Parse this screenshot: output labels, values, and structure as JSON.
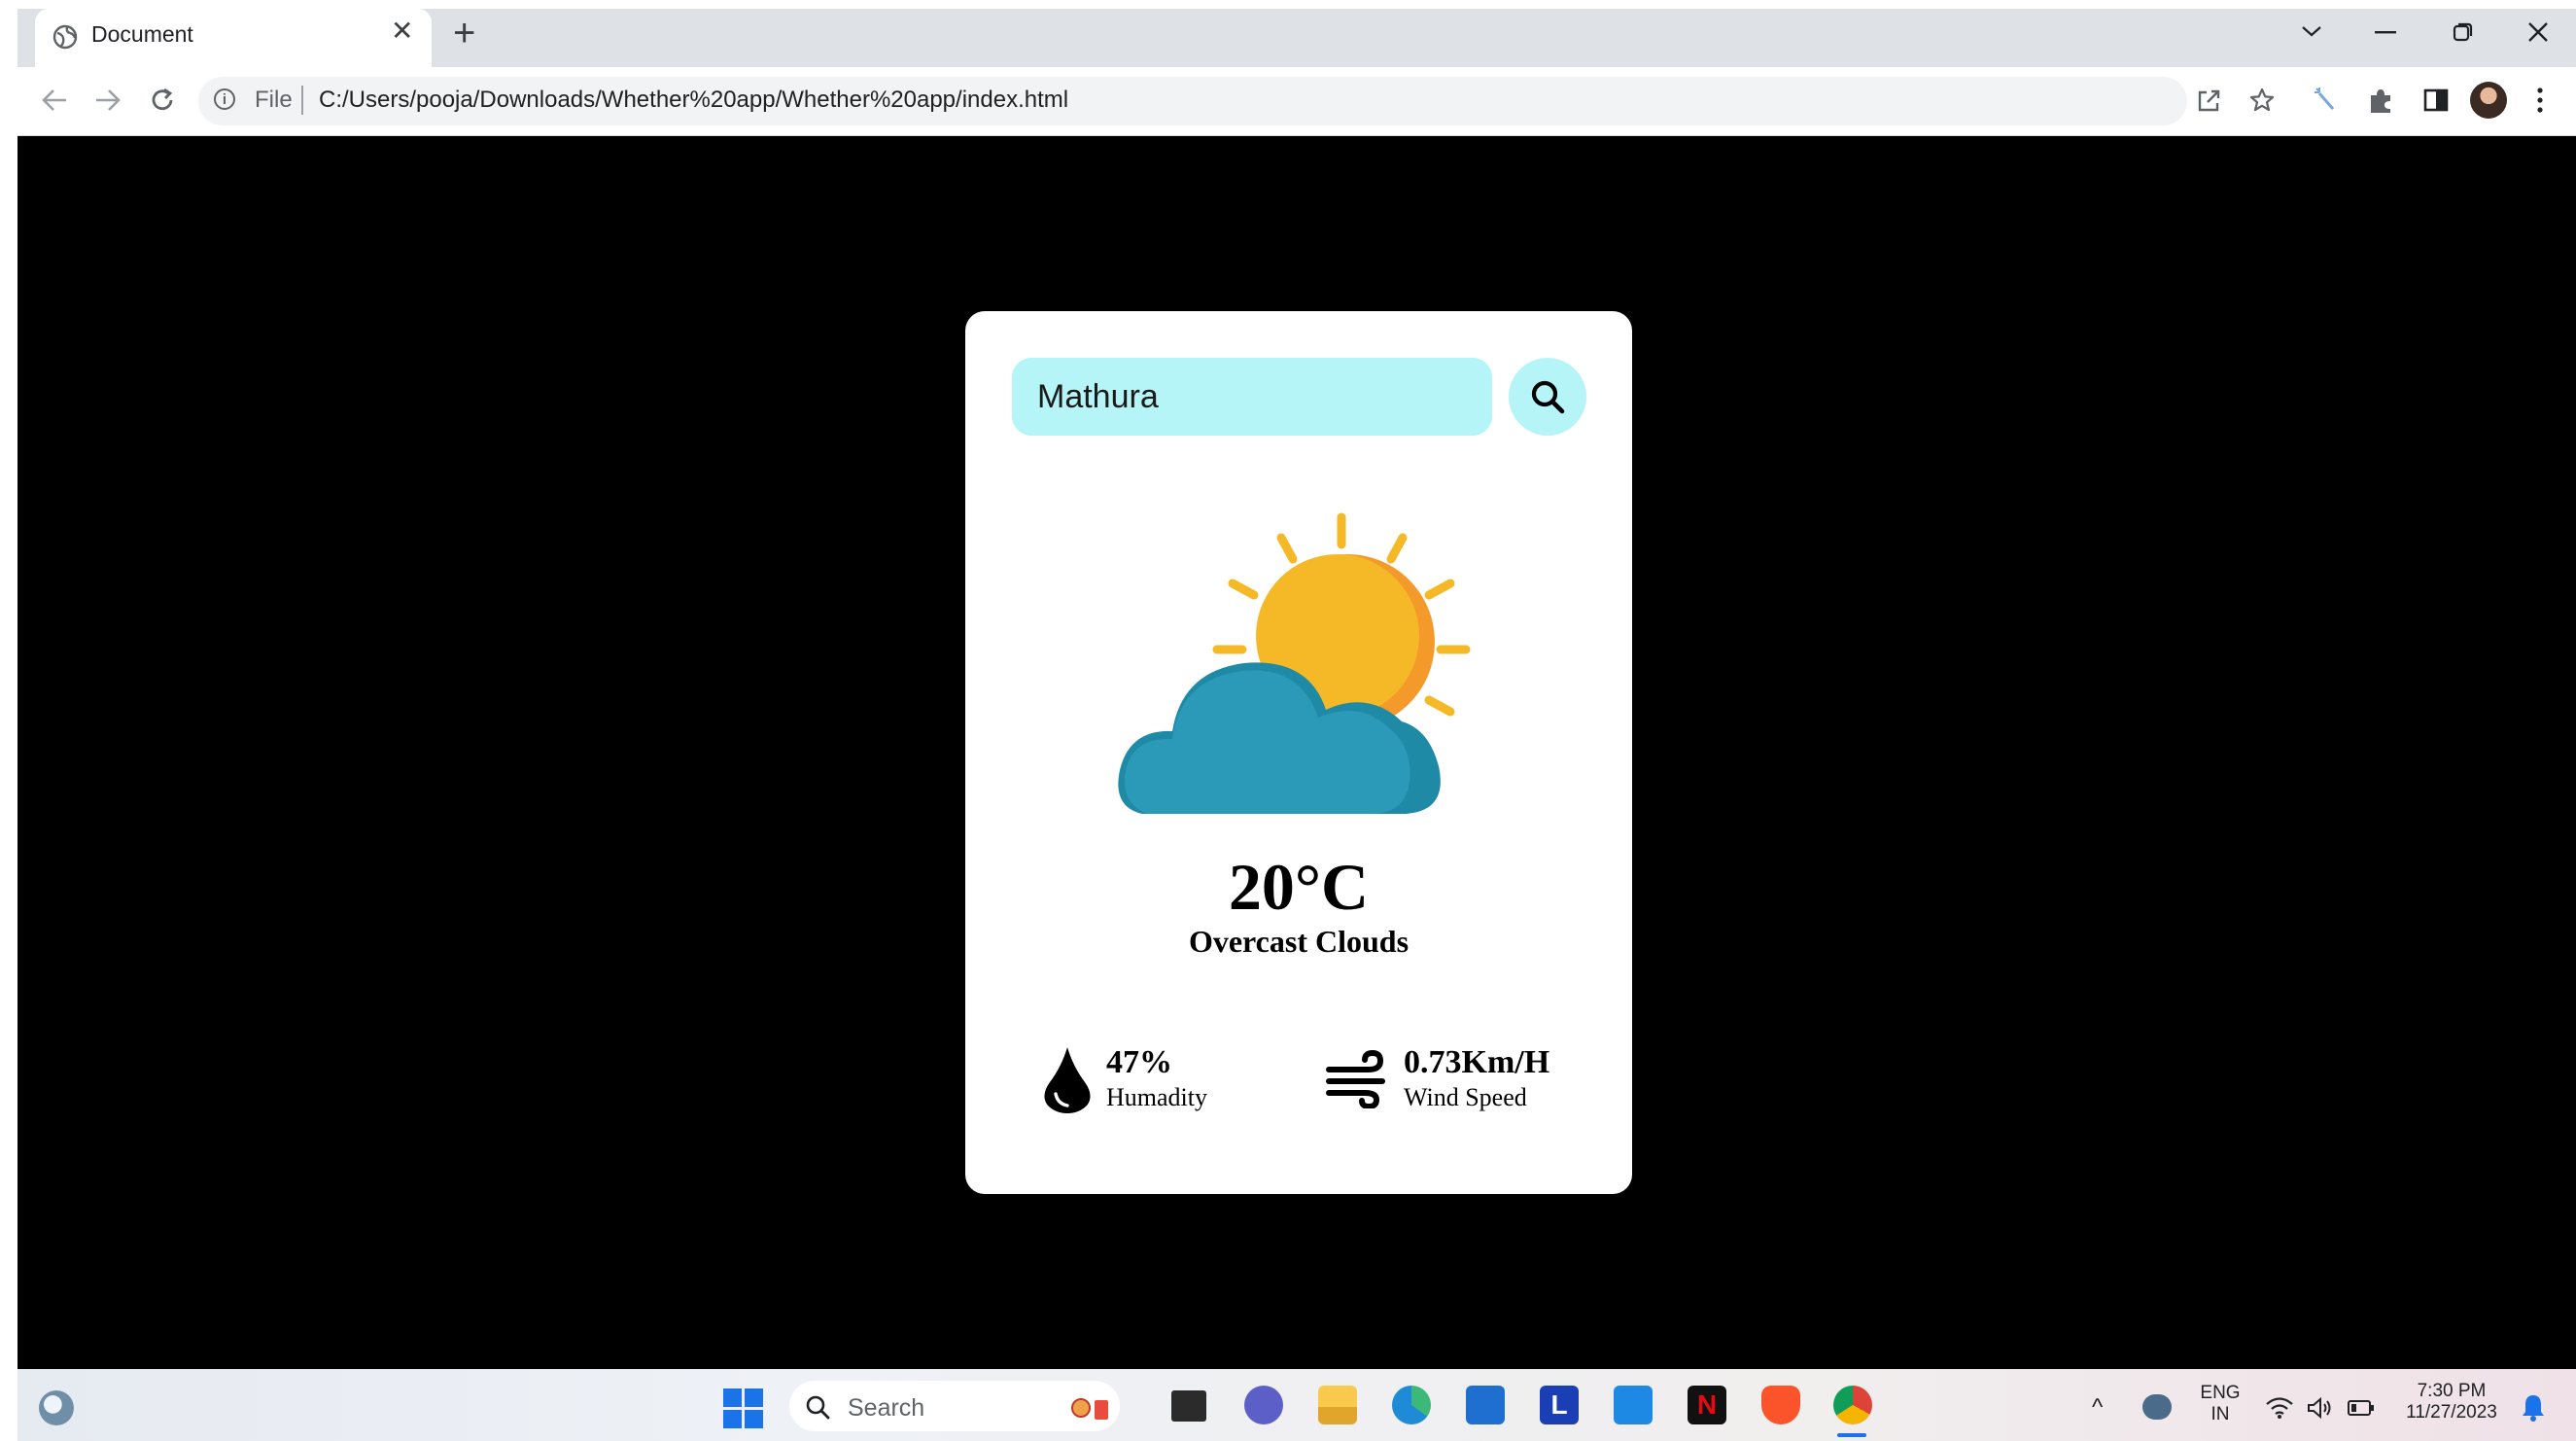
{
  "browser": {
    "tab_title": "Document",
    "tab_close": "✕",
    "new_tab": "+",
    "file_label": "File",
    "url": "C:/Users/pooja/Downloads/Whether%20app/Whether%20app/index.html",
    "info_glyph": "i"
  },
  "weather": {
    "city_value": "Mathura",
    "temperature": "20°C",
    "condition": "Overcast Clouds",
    "humidity_value": "47%",
    "humidity_label": "Humadity",
    "wind_value": "0.73Km/H",
    "wind_label": "Wind Speed",
    "icon": "sun-behind-cloud-icon"
  },
  "taskbar": {
    "search_label": "Search",
    "lang_top": "ENG",
    "lang_bottom": "IN",
    "time": "7:30 PM",
    "date": "11/27/2023",
    "chevron": "^"
  },
  "colors": {
    "page_background": "#000000",
    "card": "#ffffff",
    "search_accent": "#b5f5f7",
    "sun": "#f5b928",
    "cloud": "#2a9ab8"
  }
}
